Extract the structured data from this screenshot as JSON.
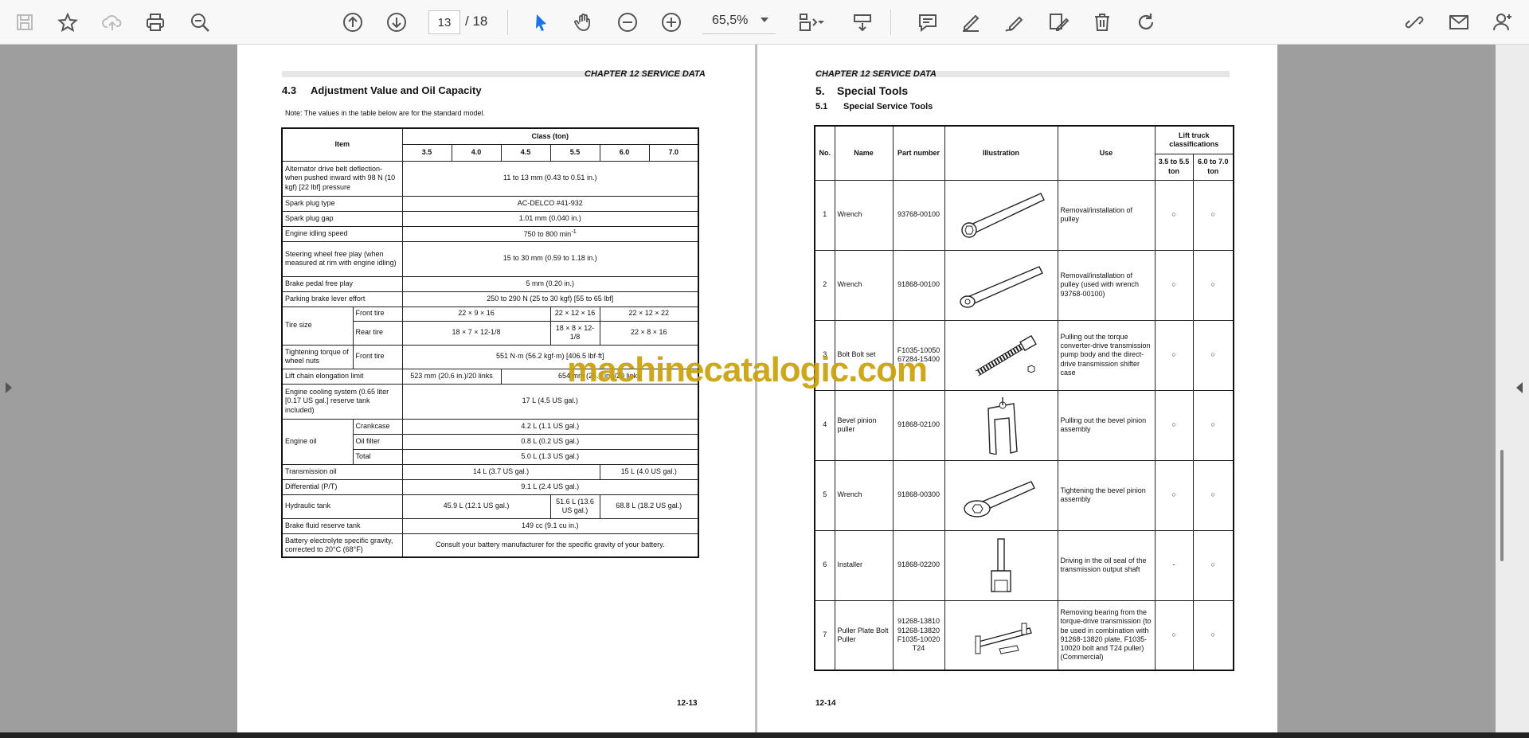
{
  "toolbar": {
    "page_current": "13",
    "page_total": "/ 18",
    "zoom": "65,5%"
  },
  "left_page": {
    "chapter": "CHAPTER 12 SERVICE DATA",
    "section_number": "4.3",
    "section_title": "Adjustment Value and Oil Capacity",
    "note": "Note: The values in the table below are for the standard model.",
    "page_number": "12-13",
    "table": {
      "item_header": "Item",
      "class_header": "Class (ton)",
      "classes": [
        "3.5",
        "4.0",
        "4.5",
        "5.5",
        "6.0",
        "7.0"
      ],
      "rows": {
        "belt_item": "Alternator drive belt deflection- when pushed inward with 98 N (10 kgf) [22 lbf] pressure",
        "belt_val": "11 to 13 mm (0.43 to 0.51 in.)",
        "plug_type_item": "Spark plug type",
        "plug_type_val": "AC-DELCO #41-932",
        "plug_gap_item": "Spark plug gap",
        "plug_gap_val": "1.01 mm (0.040 in.)",
        "idle_item": "Engine idling speed",
        "idle_val": "750 to 800 min",
        "idle_sup": "-1",
        "steer_item": "Steering wheel free play (when measured at rim with engine idling)",
        "steer_val": "15 to 30 mm (0.59 to 1.18 in.)",
        "brake_item": "Brake pedal free play",
        "brake_val": "5 mm (0.20 in.)",
        "park_item": "Parking brake lever effort",
        "park_val": "250 to 290 N (25 to 30 kgf) [55 to 65 lbf]",
        "tire_item": "Tire size",
        "front_tire": "Front tire",
        "front_a": "22 × 9 × 16",
        "front_b": "22 × 12 × 16",
        "front_c": "22 × 12 × 22",
        "rear_tire": "Rear tire",
        "rear_a": "18 × 7 × 12-1/8",
        "rear_b": "18 × 8 × 12-1/8",
        "rear_c": "22 × 8 × 16",
        "torque_item": "Tightening torque of wheel nuts",
        "torque_sub": "Front tire",
        "torque_val": "551 N·m (56.2 kgf·m) [406.5 lbf·ft]",
        "chain_item": "Lift chain elongation limit",
        "chain_a": "523 mm (20.6 in.)/20 links",
        "chain_b": "654 mm (25.7 in.)/20 links",
        "cool_item": "Engine cooling system (0.65 liter [0.17 US gal.] reserve tank included)",
        "cool_val": "17 L (4.5 US gal.)",
        "oil_item": "Engine oil",
        "crankcase": "Crankcase",
        "crankcase_val": "4.2 L (1.1 US gal.)",
        "oil_filter": "Oil filter",
        "oil_filter_val": "0.8 L (0.2 US gal.)",
        "total": "Total",
        "total_val": "5.0 L (1.3 US gal.)",
        "trans_item": "Transmission oil",
        "trans_a": "14 L (3.7 US gal.)",
        "trans_b": "15 L (4.0 US gal.)",
        "diff_item": "Differential (P/T)",
        "diff_val": "9.1 L (2.4 US gal.)",
        "hyd_item": "Hydraulic tank",
        "hyd_a": "45.9 L (12.1 US gal.)",
        "hyd_b": "51.6 L (13.6 US gal.)",
        "hyd_c": "68.8 L (18.2 US gal.)",
        "fluid_item": "Brake fluid reserve tank",
        "fluid_val": "149 cc (9.1 cu in.)",
        "batt_item": "Battery electrolyte specific gravity, corrected to 20°C (68°F)",
        "batt_val": "Consult your battery manufacturer for the specific gravity of your battery."
      }
    }
  },
  "right_page": {
    "chapter": "CHAPTER 12 SERVICE DATA",
    "section_number": "5.",
    "section_title": "Special Tools",
    "sub_number": "5.1",
    "sub_title": "Special Service Tools",
    "page_number": "12-14",
    "headers": {
      "no": "No.",
      "name": "Name",
      "part": "Part number",
      "illus": "Illustration",
      "use": "Use",
      "class": "Lift truck classifications",
      "c1": "3.5 to 5.5 ton",
      "c2": "6.0 to 7.0 ton"
    },
    "tools": [
      {
        "no": "1",
        "name": "Wrench",
        "part": "93768-00100",
        "use": "Removal/installation of pulley",
        "c1": "○",
        "c2": "○"
      },
      {
        "no": "2",
        "name": "Wrench",
        "part": "91868-00100",
        "use": "Removal/installation of pulley (used with wrench 93768-00100)",
        "c1": "○",
        "c2": "○"
      },
      {
        "no": "3",
        "name": "Bolt Bolt set",
        "part": "F1035-10050 67284-15400",
        "use": "Pulling out the torque converter-drive transmission pump body and the direct-drive transmission shifter case",
        "c1": "○",
        "c2": "○"
      },
      {
        "no": "4",
        "name": "Bevel pinion puller",
        "part": "91868-02100",
        "use": "Pulling out the bevel pinion assembly",
        "c1": "○",
        "c2": "○"
      },
      {
        "no": "5",
        "name": "Wrench",
        "part": "91868-00300",
        "use": "Tightening the bevel pinion assembly",
        "c1": "○",
        "c2": "○"
      },
      {
        "no": "6",
        "name": "Installer",
        "part": "91868-02200",
        "use": "Driving in the oil seal of the transmission output shaft",
        "c1": "-",
        "c2": "○"
      },
      {
        "no": "7",
        "name": "Puller Plate Bolt Puller",
        "part": "91268-13810 91268-13820 F1035-10020 T24",
        "use": "Removing bearing from the torque-drive transmission (to be used in combination with 91268-13820 plate, F1035-10020 bolt and T24 puller) (Commercial)",
        "c1": "○",
        "c2": "○"
      }
    ]
  },
  "watermark": "machinecatalogic.com",
  "colors": {
    "watermark": "#c9a10a",
    "accent": "#1a73e8",
    "toolbar": "#f8f8f8"
  }
}
